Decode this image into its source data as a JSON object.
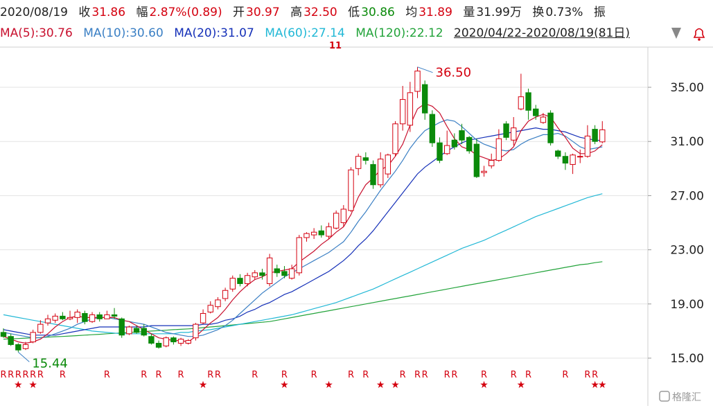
{
  "header": {
    "date": "2020/08/19",
    "close_label": "收",
    "close": "31.86",
    "change_label": "幅",
    "change": "2.87%(0.89)",
    "open_label": "开",
    "open": "30.97",
    "high_label": "高",
    "high": "32.50",
    "low_label": "低",
    "low": "30.86",
    "avg_label": "均",
    "avg": "31.89",
    "vol_label": "量",
    "vol": "31.99万",
    "turnover_label": "换",
    "turnover": "0.73%",
    "amp_label": "振"
  },
  "ma_legend": [
    {
      "text": "MA(5):30.76",
      "color": "#c8102e"
    },
    {
      "text": "MA(10):30.60",
      "color": "#3a7fc4"
    },
    {
      "text": "MA(20):31.07",
      "color": "#1530b8"
    },
    {
      "text": "MA(60):27.14",
      "color": "#22b8d6"
    },
    {
      "text": "MA(120):22.12",
      "color": "#22a33a"
    }
  ],
  "range_label": "2020/04/22-2020/08/19(81日)",
  "watermark": "格隆汇",
  "chart_data": {
    "type": "candlestick",
    "ylim": [
      13.0,
      38.0
    ],
    "y_ticks": [
      "35.00",
      "31.00",
      "27.00",
      "23.00",
      "19.00",
      "15.00"
    ],
    "annotations": {
      "max_label": "36.50",
      "min_label": "15.44",
      "top_marker": "11"
    },
    "colors": {
      "up": "#d4000f",
      "down": "#0a8a0a"
    },
    "candles": [
      [
        16.9,
        16.6,
        17.2,
        16.5
      ],
      [
        16.6,
        16.0,
        16.8,
        15.9
      ],
      [
        16.0,
        15.6,
        16.1,
        15.44
      ],
      [
        15.7,
        16.0,
        16.2,
        15.6
      ],
      [
        16.2,
        16.9,
        17.1,
        16.1
      ],
      [
        16.9,
        17.5,
        17.8,
        16.8
      ],
      [
        17.6,
        17.9,
        18.2,
        17.4
      ],
      [
        17.8,
        18.1,
        18.3,
        17.6
      ],
      [
        18.1,
        17.9,
        18.4,
        17.8
      ],
      [
        17.9,
        18.0,
        18.5,
        17.8
      ],
      [
        18.0,
        18.4,
        18.6,
        17.6
      ],
      [
        18.3,
        17.7,
        18.5,
        17.5
      ],
      [
        17.7,
        18.2,
        18.4,
        17.6
      ],
      [
        18.2,
        17.9,
        18.4,
        17.7
      ],
      [
        17.9,
        18.2,
        18.5,
        17.9
      ],
      [
        18.2,
        18.1,
        18.7,
        17.9
      ],
      [
        17.9,
        16.7,
        18.0,
        16.5
      ],
      [
        16.8,
        17.3,
        17.4,
        16.7
      ],
      [
        17.2,
        16.9,
        17.4,
        16.8
      ],
      [
        17.2,
        16.7,
        17.5,
        16.6
      ],
      [
        16.6,
        16.1,
        16.8,
        16.0
      ],
      [
        16.1,
        15.8,
        16.3,
        15.7
      ],
      [
        15.9,
        16.5,
        16.6,
        15.8
      ],
      [
        16.5,
        16.2,
        16.6,
        16.0
      ],
      [
        16.1,
        16.4,
        16.5,
        15.9
      ],
      [
        16.1,
        16.3,
        16.4,
        16.0
      ],
      [
        16.5,
        17.5,
        17.6,
        16.3
      ],
      [
        17.6,
        18.3,
        18.6,
        17.5
      ],
      [
        18.4,
        18.9,
        19.2,
        18.3
      ],
      [
        18.8,
        19.3,
        19.5,
        18.6
      ],
      [
        19.4,
        20.0,
        20.2,
        19.2
      ],
      [
        20.1,
        20.9,
        21.1,
        19.9
      ],
      [
        20.9,
        20.5,
        21.2,
        20.3
      ],
      [
        20.5,
        21.1,
        21.3,
        20.3
      ],
      [
        21.0,
        21.3,
        21.5,
        20.8
      ],
      [
        21.3,
        21.1,
        21.6,
        20.8
      ],
      [
        20.5,
        22.4,
        22.7,
        20.3
      ],
      [
        21.6,
        21.3,
        21.9,
        21.0
      ],
      [
        21.4,
        21.1,
        21.8,
        20.9
      ],
      [
        20.9,
        21.6,
        21.9,
        20.8
      ],
      [
        21.3,
        23.9,
        24.1,
        21.1
      ],
      [
        23.9,
        24.2,
        24.3,
        23.6
      ],
      [
        24.1,
        24.3,
        24.6,
        23.8
      ],
      [
        24.4,
        24.1,
        24.8,
        23.9
      ],
      [
        24.0,
        24.7,
        25.0,
        23.8
      ],
      [
        24.6,
        25.7,
        25.9,
        24.5
      ],
      [
        25.0,
        26.0,
        26.3,
        24.7
      ],
      [
        25.9,
        28.9,
        29.1,
        25.8
      ],
      [
        29.0,
        29.9,
        30.1,
        28.5
      ],
      [
        29.8,
        29.6,
        30.2,
        29.3
      ],
      [
        29.3,
        27.8,
        29.6,
        27.5
      ],
      [
        27.8,
        29.7,
        30.2,
        27.6
      ],
      [
        28.6,
        30.0,
        30.1,
        28.3
      ],
      [
        30.1,
        32.3,
        32.5,
        29.9
      ],
      [
        32.3,
        34.1,
        35.1,
        31.8
      ],
      [
        32.2,
        34.6,
        35.4,
        31.7
      ],
      [
        34.7,
        36.2,
        36.5,
        34.2
      ],
      [
        35.2,
        33.1,
        35.5,
        32.6
      ],
      [
        33.0,
        30.9,
        33.3,
        30.6
      ],
      [
        30.9,
        29.6,
        31.3,
        29.4
      ],
      [
        30.1,
        30.7,
        31.8,
        30.0
      ],
      [
        31.1,
        30.6,
        31.6,
        30.4
      ],
      [
        31.8,
        31.1,
        32.3,
        30.8
      ],
      [
        31.3,
        30.3,
        31.4,
        30.1
      ],
      [
        30.8,
        28.4,
        31.2,
        28.3
      ],
      [
        28.7,
        28.8,
        29.2,
        28.4
      ],
      [
        29.2,
        29.6,
        30.1,
        29.0
      ],
      [
        29.6,
        31.2,
        31.9,
        29.5
      ],
      [
        32.3,
        31.3,
        32.5,
        31.1
      ],
      [
        31.1,
        32.0,
        32.8,
        30.7
      ],
      [
        33.4,
        34.3,
        36.0,
        33.3
      ],
      [
        34.6,
        33.3,
        34.9,
        32.6
      ],
      [
        33.4,
        32.9,
        33.7,
        32.6
      ],
      [
        32.4,
        32.8,
        33.1,
        32.3
      ],
      [
        33.1,
        30.9,
        33.3,
        30.7
      ],
      [
        30.3,
        29.9,
        30.4,
        29.7
      ],
      [
        29.9,
        29.4,
        30.2,
        28.9
      ],
      [
        29.3,
        30.0,
        30.1,
        28.6
      ],
      [
        29.9,
        29.9,
        30.4,
        29.4
      ],
      [
        29.9,
        31.4,
        32.2,
        29.8
      ],
      [
        31.9,
        31.0,
        32.2,
        30.8
      ],
      [
        30.97,
        31.86,
        32.5,
        30.86
      ]
    ],
    "ma5": [
      16.6,
      16.4,
      16.2,
      16.1,
      16.2,
      16.4,
      16.8,
      17.3,
      17.7,
      18.0,
      18.1,
      18.0,
      18.0,
      18.0,
      18.0,
      18.0,
      17.8,
      17.7,
      17.4,
      17.1,
      16.8,
      16.5,
      16.4,
      16.3,
      16.3,
      16.2,
      16.6,
      17.1,
      17.6,
      18.0,
      18.6,
      19.3,
      19.9,
      20.4,
      20.8,
      21.0,
      21.3,
      21.4,
      21.5,
      21.6,
      22.1,
      22.5,
      22.9,
      23.4,
      23.8,
      24.3,
      24.7,
      25.6,
      26.9,
      27.8,
      28.3,
      28.9,
      29.2,
      29.9,
      30.8,
      32.2,
      33.4,
      33.8,
      33.6,
      33.1,
      32.1,
      31.2,
      30.6,
      30.4,
      30.0,
      29.8,
      29.6,
      29.7,
      30.1,
      30.6,
      31.8,
      32.5,
      32.8,
      33.0,
      32.8,
      32.0,
      31.3,
      30.5,
      30.1,
      30.1,
      30.3,
      30.76
    ],
    "ma10": [
      16.9,
      16.8,
      16.7,
      16.6,
      16.5,
      16.5,
      16.6,
      16.8,
      17.0,
      17.2,
      17.5,
      17.7,
      17.9,
      18.0,
      18.0,
      17.9,
      17.8,
      17.7,
      17.6,
      17.5,
      17.3,
      17.1,
      16.9,
      16.8,
      16.7,
      16.6,
      16.6,
      16.7,
      16.9,
      17.1,
      17.4,
      17.8,
      18.3,
      18.8,
      19.3,
      19.8,
      20.2,
      20.6,
      21.0,
      21.3,
      21.6,
      21.9,
      22.2,
      22.5,
      22.8,
      23.2,
      23.6,
      24.3,
      25.1,
      25.8,
      26.6,
      27.4,
      28.1,
      28.8,
      29.6,
      30.5,
      31.2,
      31.8,
      32.1,
      32.4,
      32.6,
      32.5,
      32.1,
      31.6,
      31.1,
      30.8,
      30.6,
      30.4,
      30.3,
      30.4,
      30.8,
      31.1,
      31.3,
      31.5,
      31.5,
      31.6,
      31.4,
      31.0,
      30.6,
      30.4,
      30.5,
      30.6
    ],
    "ma20": [
      17.1,
      17.0,
      16.9,
      16.8,
      16.7,
      16.7,
      16.7,
      16.7,
      16.8,
      16.9,
      17.0,
      17.1,
      17.2,
      17.3,
      17.3,
      17.3,
      17.3,
      17.3,
      17.3,
      17.3,
      17.4,
      17.4,
      17.4,
      17.4,
      17.4,
      17.4,
      17.4,
      17.5,
      17.5,
      17.6,
      17.8,
      17.9,
      18.1,
      18.4,
      18.6,
      18.9,
      19.1,
      19.4,
      19.7,
      19.9,
      20.2,
      20.5,
      20.8,
      21.1,
      21.4,
      21.8,
      22.2,
      22.7,
      23.3,
      23.8,
      24.4,
      25.1,
      25.8,
      26.5,
      27.2,
      27.9,
      28.6,
      29.1,
      29.5,
      29.9,
      30.3,
      30.6,
      30.9,
      31.1,
      31.2,
      31.3,
      31.4,
      31.5,
      31.6,
      31.7,
      31.8,
      31.9,
      32.0,
      31.9,
      31.9,
      31.8,
      31.7,
      31.5,
      31.3,
      31.2,
      31.1,
      31.07
    ],
    "ma60": [
      18.2,
      18.1,
      18.0,
      17.9,
      17.8,
      17.7,
      17.6,
      17.5,
      17.4,
      17.3,
      17.2,
      17.1,
      17.0,
      16.95,
      16.9,
      16.85,
      16.8,
      16.8,
      16.8,
      16.8,
      16.8,
      16.8,
      16.8,
      16.8,
      16.9,
      16.9,
      17.0,
      17.05,
      17.1,
      17.2,
      17.3,
      17.4,
      17.5,
      17.6,
      17.7,
      17.8,
      17.9,
      18.0,
      18.1,
      18.2,
      18.35,
      18.5,
      18.65,
      18.8,
      18.95,
      19.1,
      19.3,
      19.5,
      19.7,
      19.9,
      20.1,
      20.35,
      20.6,
      20.85,
      21.1,
      21.35,
      21.6,
      21.85,
      22.1,
      22.35,
      22.6,
      22.85,
      23.1,
      23.3,
      23.5,
      23.7,
      23.95,
      24.2,
      24.45,
      24.7,
      24.95,
      25.2,
      25.45,
      25.65,
      25.85,
      26.05,
      26.25,
      26.45,
      26.65,
      26.85,
      27.0,
      27.14
    ],
    "ma120": [
      16.4,
      16.42,
      16.45,
      16.48,
      16.5,
      16.52,
      16.55,
      16.58,
      16.6,
      16.63,
      16.66,
      16.7,
      16.73,
      16.76,
      16.8,
      16.83,
      16.86,
      16.9,
      16.93,
      16.96,
      17.0,
      17.03,
      17.06,
      17.1,
      17.13,
      17.16,
      17.2,
      17.25,
      17.3,
      17.35,
      17.4,
      17.45,
      17.5,
      17.55,
      17.6,
      17.65,
      17.7,
      17.8,
      17.9,
      18.0,
      18.1,
      18.2,
      18.3,
      18.4,
      18.5,
      18.6,
      18.7,
      18.8,
      18.9,
      19.0,
      19.1,
      19.2,
      19.3,
      19.4,
      19.5,
      19.6,
      19.7,
      19.8,
      19.9,
      20.0,
      20.1,
      20.2,
      20.3,
      20.4,
      20.5,
      20.6,
      20.7,
      20.8,
      20.9,
      21.0,
      21.1,
      21.2,
      21.3,
      21.4,
      21.5,
      21.6,
      21.7,
      21.8,
      21.9,
      21.95,
      22.05,
      22.12
    ],
    "signals": [
      {
        "i": 0,
        "t": "R"
      },
      {
        "i": 1,
        "t": "R"
      },
      {
        "i": 2,
        "t": "R"
      },
      {
        "i": 3,
        "t": "R"
      },
      {
        "i": 4,
        "t": "R"
      },
      {
        "i": 5,
        "t": "R"
      },
      {
        "i": 8,
        "t": "R"
      },
      {
        "i": 14,
        "t": "R"
      },
      {
        "i": 19,
        "t": "R"
      },
      {
        "i": 21,
        "t": "R"
      },
      {
        "i": 24,
        "t": "R"
      },
      {
        "i": 28,
        "t": "R"
      },
      {
        "i": 29,
        "t": "R"
      },
      {
        "i": 34,
        "t": "R"
      },
      {
        "i": 38,
        "t": "R"
      },
      {
        "i": 42,
        "t": "R"
      },
      {
        "i": 47,
        "t": "R"
      },
      {
        "i": 49,
        "t": "R"
      },
      {
        "i": 54,
        "t": "R"
      },
      {
        "i": 56,
        "t": "R"
      },
      {
        "i": 57,
        "t": "R"
      },
      {
        "i": 60,
        "t": "R"
      },
      {
        "i": 61,
        "t": "R"
      },
      {
        "i": 65,
        "t": "R"
      },
      {
        "i": 69,
        "t": "R"
      },
      {
        "i": 71,
        "t": "R"
      },
      {
        "i": 76,
        "t": "R"
      },
      {
        "i": 79,
        "t": "R"
      },
      {
        "i": 80,
        "t": "R"
      },
      {
        "i": 2,
        "t": "★"
      },
      {
        "i": 4,
        "t": "★"
      },
      {
        "i": 27,
        "t": "★"
      },
      {
        "i": 38,
        "t": "★"
      },
      {
        "i": 44,
        "t": "★"
      },
      {
        "i": 51,
        "t": "★"
      },
      {
        "i": 53,
        "t": "★"
      },
      {
        "i": 65,
        "t": "★"
      },
      {
        "i": 70,
        "t": "★"
      },
      {
        "i": 80,
        "t": "★"
      },
      {
        "i": 81,
        "t": "★"
      }
    ]
  }
}
